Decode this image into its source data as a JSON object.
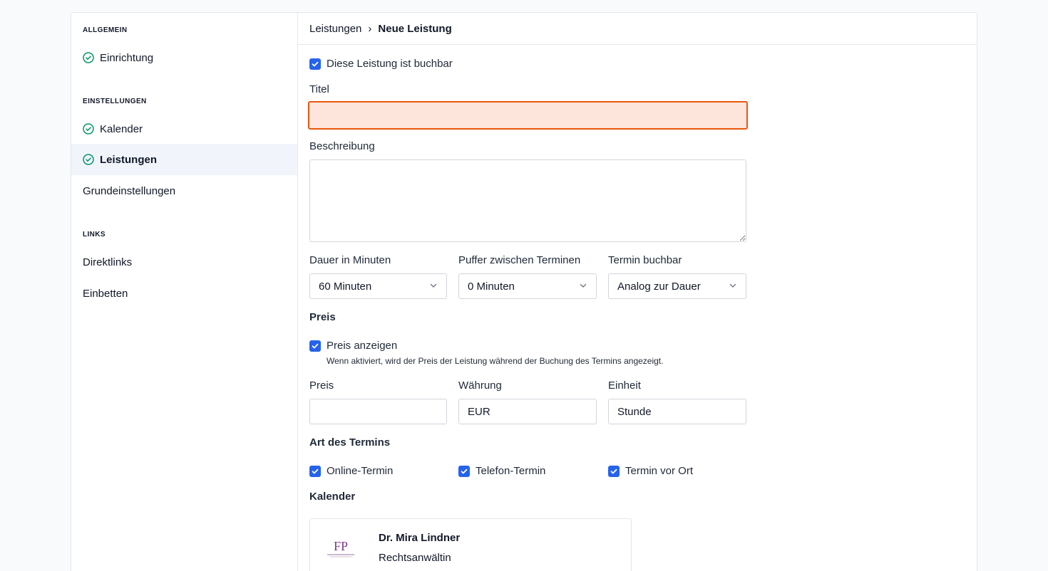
{
  "sidebar": {
    "sections": [
      {
        "heading": "ALLGEMEIN",
        "items": [
          {
            "label": "Einrichtung",
            "done": true
          }
        ]
      },
      {
        "heading": "EINSTELLUNGEN",
        "items": [
          {
            "label": "Kalender",
            "done": true
          },
          {
            "label": "Leistungen",
            "done": true,
            "active": true
          },
          {
            "label": "Grundeinstellungen",
            "done": false
          }
        ]
      },
      {
        "heading": "LINKS",
        "items": [
          {
            "label": "Direktlinks",
            "done": false
          },
          {
            "label": "Einbetten",
            "done": false
          }
        ]
      }
    ]
  },
  "breadcrumb": {
    "parent": "Leistungen",
    "separator": "›",
    "current": "Neue Leistung"
  },
  "form": {
    "bookable": {
      "label": "Diese Leistung ist buchbar",
      "checked": true
    },
    "title": {
      "label": "Titel",
      "value": "",
      "placeholder": ""
    },
    "description": {
      "label": "Beschreibung",
      "value": ""
    },
    "duration": {
      "label": "Dauer in Minuten",
      "value": "60 Minuten"
    },
    "buffer": {
      "label": "Puffer zwischen Terminen",
      "value": "0 Minuten"
    },
    "bookable_slot": {
      "label": "Termin buchbar",
      "value": "Analog zur Dauer"
    },
    "price_section": "Preis",
    "show_price": {
      "label": "Preis anzeigen",
      "checked": true,
      "hint": "Wenn aktiviert, wird der Preis der Leistung während der Buchung des Termins angezeigt."
    },
    "price": {
      "label": "Preis",
      "value": ""
    },
    "currency": {
      "label": "Währung",
      "value": "EUR"
    },
    "unit": {
      "label": "Einheit",
      "value": "Stunde"
    },
    "type_section": "Art des Termins",
    "types": [
      {
        "label": "Online-Termin",
        "checked": true
      },
      {
        "label": "Telefon-Termin",
        "checked": true
      },
      {
        "label": "Termin vor Ort",
        "checked": true
      }
    ],
    "calendar_section": "Kalender",
    "calendar": {
      "name": "Dr. Mira Lindner",
      "role": "Rechtsanwältin",
      "logo_text": "FP"
    }
  },
  "colors": {
    "accent": "#2563eb",
    "success": "#059669",
    "error_border": "#ea580c",
    "error_bg": "#fde5db"
  }
}
